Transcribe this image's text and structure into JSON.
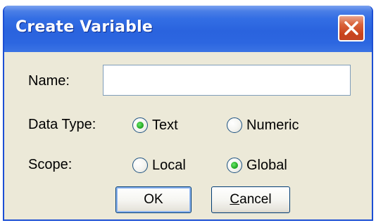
{
  "window": {
    "title": "Create Variable",
    "close_icon": "close-icon"
  },
  "form": {
    "name_label": "Name:",
    "name_value": "",
    "data_type_label": "Data Type:",
    "data_type_options": [
      {
        "label": "Text",
        "selected": true
      },
      {
        "label": "Numeric",
        "selected": false
      }
    ],
    "scope_label": "Scope:",
    "scope_options": [
      {
        "label": "Local",
        "selected": false
      },
      {
        "label": "Global",
        "selected": true
      }
    ]
  },
  "buttons": {
    "ok_label": "OK",
    "cancel_label_first": "C",
    "cancel_label_rest": "ancel"
  },
  "colors": {
    "titlebar": "#2a63de",
    "dialog_bg": "#ece9d8",
    "close_button": "#c9421c",
    "radio_dot": "#2aaf2a"
  }
}
